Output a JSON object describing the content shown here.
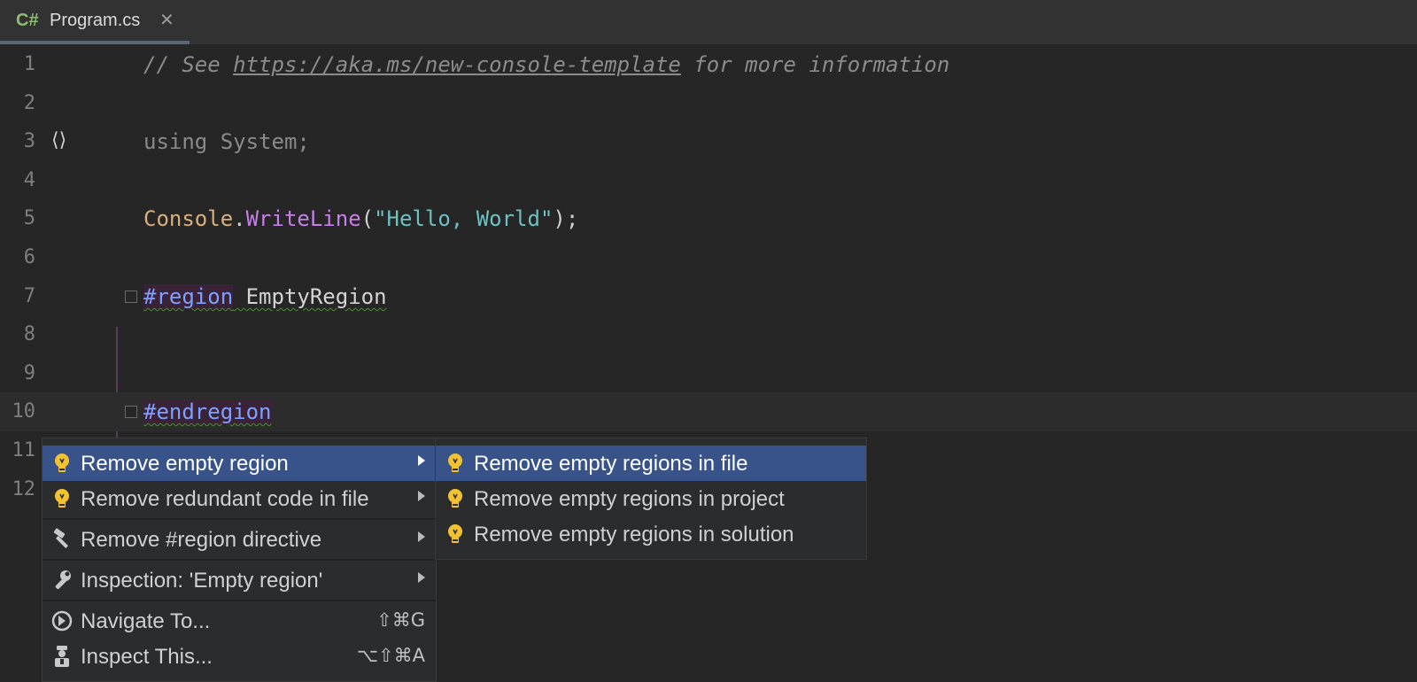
{
  "tab": {
    "lang_icon": "C#",
    "title": "Program.cs",
    "close": "✕"
  },
  "lines": [
    {
      "n": "1"
    },
    {
      "n": "2"
    },
    {
      "n": "3"
    },
    {
      "n": "4"
    },
    {
      "n": "5"
    },
    {
      "n": "6"
    },
    {
      "n": "7"
    },
    {
      "n": "8"
    },
    {
      "n": "9"
    },
    {
      "n": "10"
    },
    {
      "n": "11"
    },
    {
      "n": "12"
    }
  ],
  "code": {
    "l1_comment_pre": "// See ",
    "l1_link": "https://aka.ms/new-console-template",
    "l1_comment_post": " for more information",
    "l3": "using System;",
    "l5_class": "Console",
    "l5_dot": ".",
    "l5_method": "WriteLine",
    "l5_open": "(",
    "l5_string": "\"Hello, World\"",
    "l5_close": ");",
    "l7_directive": "#region",
    "l7_name": " EmptyRegion",
    "l10_directive": "#endregion"
  },
  "gutter": {
    "namespace_icon": "⟨⟩"
  },
  "menu": {
    "items": [
      {
        "label": "Remove empty region",
        "icon": "bulb-icon"
      },
      {
        "label": "Remove redundant code in file",
        "icon": "bulb-icon"
      },
      {
        "label": "Remove #region directive",
        "icon": "hammer-icon"
      },
      {
        "label": "Inspection: 'Empty region'",
        "icon": "wrench-icon"
      },
      {
        "label": "Navigate To...",
        "icon": "navigate-icon",
        "shortcut": "⇧⌘G"
      },
      {
        "label": "Inspect This...",
        "icon": "inspector-icon",
        "shortcut": "⌥⇧⌘A"
      }
    ]
  },
  "submenu": {
    "items": [
      {
        "label": "Remove empty regions in file"
      },
      {
        "label": "Remove empty regions in project"
      },
      {
        "label": "Remove empty regions in solution"
      }
    ]
  },
  "colors": {
    "selection": "#375389",
    "bulb": "#f2c230",
    "directive": "#7ea0ff"
  }
}
